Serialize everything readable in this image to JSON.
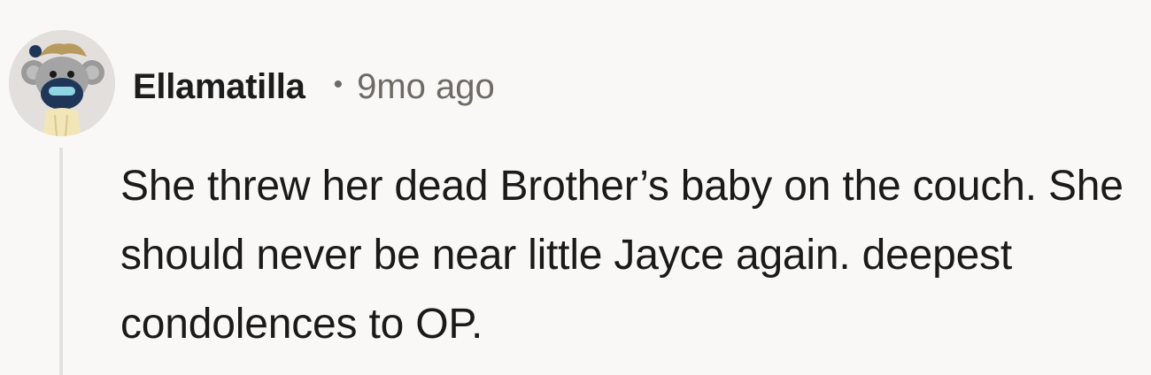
{
  "comment": {
    "author": "Ellamatilla",
    "separator": "•",
    "timestamp": "9mo ago",
    "body": "She threw her dead Brother’s baby on the couch. She should never be near little Jayce again. deepest condolences to OP.",
    "avatar_icon": "snoo-avatar-icon"
  },
  "colors": {
    "background": "#f9f8f7",
    "text": "#1a1a1a",
    "muted": "#6f6a64",
    "thread_line": "#e4e0dc"
  }
}
